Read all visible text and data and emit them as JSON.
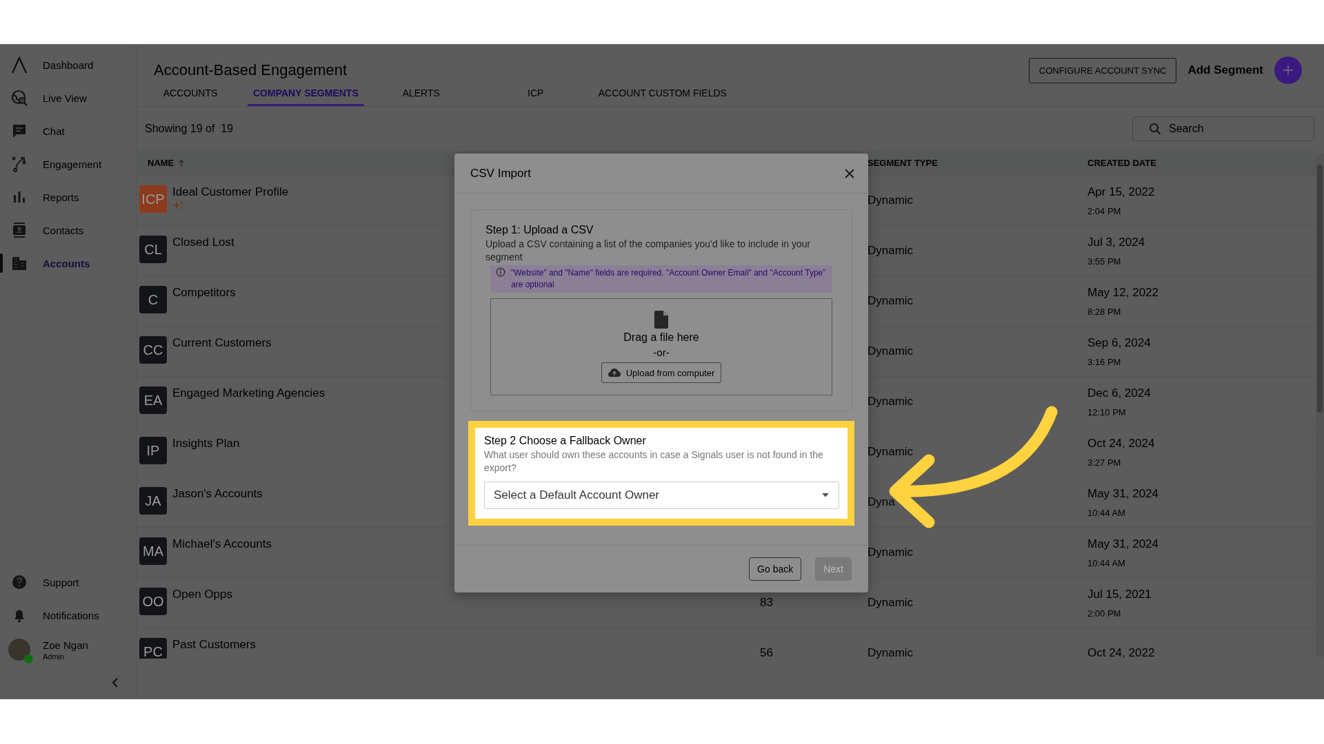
{
  "sidebar": {
    "items": [
      {
        "label": "Dashboard",
        "selected": false
      },
      {
        "label": "Live View",
        "selected": false
      },
      {
        "label": "Chat",
        "selected": false
      },
      {
        "label": "Engagement",
        "selected": false
      },
      {
        "label": "Reports",
        "selected": false
      },
      {
        "label": "Contacts",
        "selected": false
      },
      {
        "label": "Accounts",
        "selected": true
      }
    ],
    "footer_items": [
      {
        "label": "Support"
      },
      {
        "label": "Notifications"
      }
    ],
    "user": {
      "name": "Zoe Ngan",
      "role": "Admin",
      "online": true
    }
  },
  "header": {
    "title": "Account-Based Engagement",
    "tabs": [
      {
        "label": "ACCOUNTS",
        "selected": false
      },
      {
        "label": "COMPANY SEGMENTS",
        "selected": true
      },
      {
        "label": "ALERTS",
        "selected": false
      },
      {
        "label": "ICP",
        "selected": false
      },
      {
        "label": "ACCOUNT CUSTOM FIELDS",
        "selected": false
      }
    ],
    "sync_button": "CONFIGURE ACCOUNT SYNC",
    "add_label": "Add Segment"
  },
  "toolbar": {
    "showing": "Showing 19 of  19",
    "search": {
      "placeholder": "Search"
    }
  },
  "table": {
    "columns": [
      {
        "label": "NAME",
        "sorted": true
      },
      {
        "label": "SEGMENT TYPE",
        "sorted": false
      },
      {
        "label": "CREATED DATE",
        "sorted": false
      }
    ],
    "rows": [
      {
        "initials": "ICP",
        "name": "Ideal Customer Profile",
        "color": "#8c3a1d",
        "sparkle": true,
        "segment_type": "Dynamic",
        "date": "Apr 15, 2022",
        "time": "2:04 PM"
      },
      {
        "initials": "CL",
        "name": "Closed Lost",
        "color": "#121418",
        "sparkle": false,
        "segment_type": "Dynamic",
        "date": "Jul 3, 2024",
        "time": "3:55 PM"
      },
      {
        "initials": "C",
        "name": "Competitors",
        "color": "#121418",
        "sparkle": false,
        "segment_type": "Dynamic",
        "date": "May 12, 2022",
        "time": "8:28 PM"
      },
      {
        "initials": "CC",
        "name": "Current Customers",
        "color": "#121418",
        "sparkle": false,
        "segment_type": "Dynamic",
        "date": "Sep 6, 2024",
        "time": "3:16 PM"
      },
      {
        "initials": "EA",
        "name": "Engaged Marketing Agencies",
        "color": "#121418",
        "sparkle": false,
        "segment_type": "Dynamic",
        "date": "Dec 6, 2024",
        "time": "12:10 PM"
      },
      {
        "initials": "IP",
        "name": "Insights Plan",
        "color": "#121418",
        "sparkle": false,
        "segment_type": "Dynamic",
        "date": "Oct 24, 2024",
        "time": "3:27 PM"
      },
      {
        "initials": "JA",
        "name": "Jason's Accounts",
        "color": "#121418",
        "sparkle": false,
        "segment_type": "Dyna",
        "date": "May 31, 2024",
        "time": "10:44 AM"
      },
      {
        "initials": "MA",
        "name": "Michael's Accounts",
        "color": "#121418",
        "sparkle": false,
        "segment_type": "Dynamic",
        "date": "May 31, 2024",
        "time": "10:44 AM"
      },
      {
        "initials": "OO",
        "name": "Open Opps",
        "color": "#121418",
        "sparkle": false,
        "column_2": "83",
        "segment_type": "Dynamic",
        "date": "Jul 15, 2021",
        "time": "2:00 PM"
      },
      {
        "initials": "PC",
        "name": "Past Customers",
        "color": "#121418",
        "sparkle": false,
        "column_2": "56",
        "segment_type": "Dynamic",
        "date": "Oct 24, 2022"
      }
    ]
  },
  "modal": {
    "title": "CSV Import",
    "step1": {
      "title": "Step 1: Upload a CSV",
      "description": "Upload a CSV containing a list of the companies you'd like to include in your segment",
      "note": "\"Website\" and \"Name\" fields are required. \"Account Owner Email\" and \"Account Type\" are optional",
      "drop_text": "Drag a file here",
      "or_text": "-or-",
      "upload_button": "Upload from computer",
      "highlighted": false
    },
    "step2": {
      "title": "Step 2 Choose a Fallback Owner",
      "description": "What user should own these accounts in case a Signals user is not found in the export?",
      "select": {
        "placeholder": "Select a Default Account Owner"
      },
      "highlighted": true
    },
    "back_button": "Go back",
    "next_button": {
      "label": "Next",
      "disabled": true
    }
  }
}
